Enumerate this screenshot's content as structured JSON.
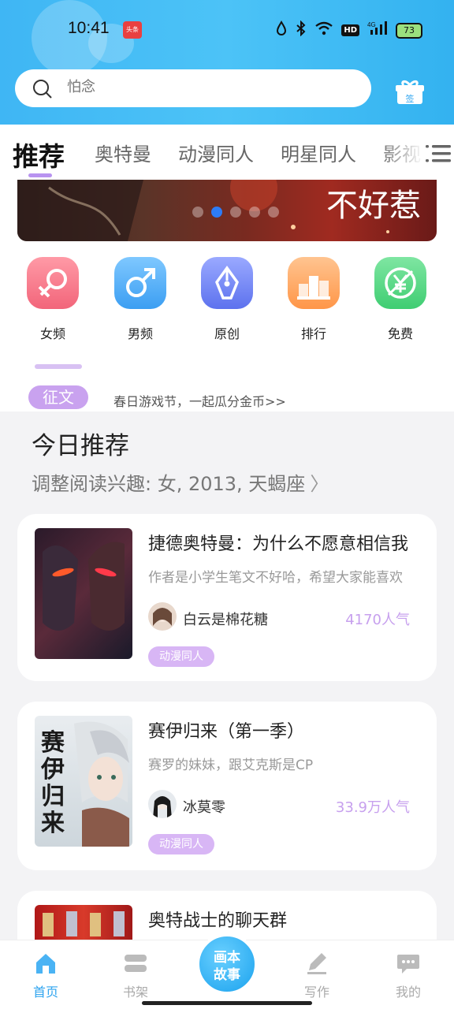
{
  "status_bar": {
    "time": "10:41",
    "toutiao_badge": "头条",
    "battery": "73",
    "hd": "HD",
    "network": "4G"
  },
  "search": {
    "placeholder": "怕念"
  },
  "gift": {
    "label": "签"
  },
  "tabs": [
    {
      "label": "推荐",
      "active": true
    },
    {
      "label": "奥特曼",
      "active": false
    },
    {
      "label": "动漫同人",
      "active": false
    },
    {
      "label": "明星同人",
      "active": false
    },
    {
      "label": "影视",
      "active": false
    }
  ],
  "banner": {
    "text": "不好惹",
    "dots": 5,
    "active_dot": 1
  },
  "categories": [
    {
      "label": "女频",
      "icon": "female-icon",
      "color": "#f36f7f"
    },
    {
      "label": "男频",
      "icon": "male-icon",
      "color": "#4aa9f4"
    },
    {
      "label": "原创",
      "icon": "pen-nib-icon",
      "color": "#6f84f2"
    },
    {
      "label": "排行",
      "icon": "podium-icon",
      "color": "#ffa860"
    },
    {
      "label": "免费",
      "icon": "yen-free-icon",
      "color": "#49d57c"
    }
  ],
  "notice": {
    "badge": "征文",
    "text": "春日游戏节，一起瓜分金币>>"
  },
  "recommend": {
    "title": "今日推荐",
    "subtitle": "调整阅读兴趣: 女, 2013, 天蝎座"
  },
  "books": [
    {
      "title": "捷德奥特曼：为什么不愿意相信我",
      "desc": "作者是小学生笔文不好哈，希望大家能喜欢",
      "author": "白云是棉花糖",
      "popularity": "4170人气",
      "tag": "动漫同人"
    },
    {
      "title": "赛伊归来（第一季）",
      "desc": "赛罗的妹妹，跟艾克斯是CP",
      "author": "冰莫零",
      "popularity": "33.9万人气",
      "tag": "动漫同人",
      "cover_text": "赛伊归来"
    },
    {
      "title": "奥特战士的聊天群"
    }
  ],
  "bottom_nav": [
    {
      "label": "首页",
      "icon": "home-icon",
      "active": true
    },
    {
      "label": "书架",
      "icon": "bookshelf-icon",
      "active": false
    },
    {
      "label": "写作",
      "icon": "write-icon",
      "active": false
    },
    {
      "label": "我的",
      "icon": "profile-icon",
      "active": false
    }
  ],
  "center_button": {
    "line1": "画本",
    "line2": "故事"
  },
  "colors": {
    "accent_blue": "#3fb6f4",
    "accent_purple": "#c9a2ef",
    "nav_active": "#2ea4ef"
  }
}
